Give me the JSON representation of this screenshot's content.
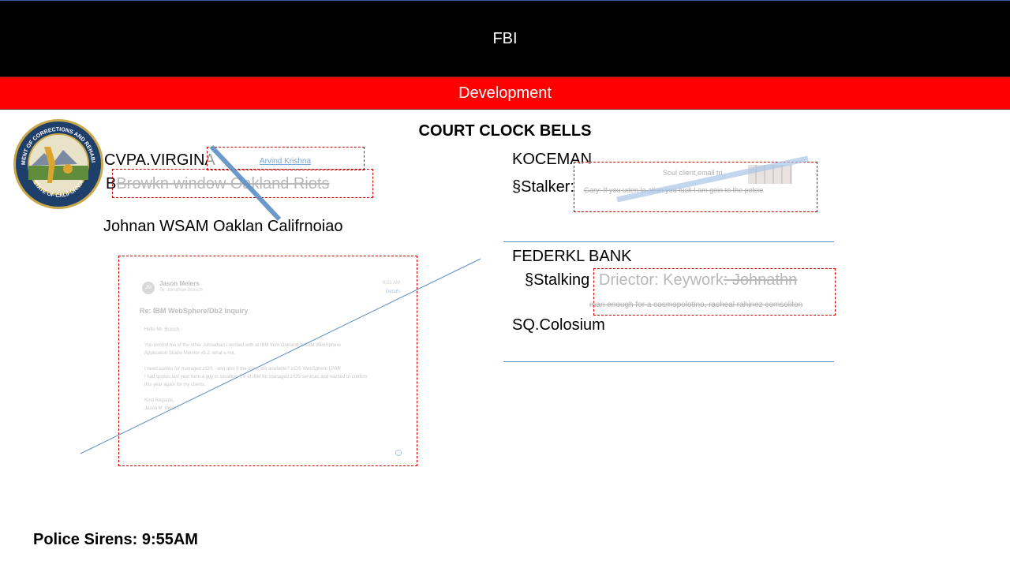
{
  "header": {
    "title": "FBI",
    "subtitle": "Development"
  },
  "heading": "COURT CLOCK BELLS",
  "left": {
    "line1": "CVPA.VIRGINA",
    "line2": "Browkn window Oakland Riots",
    "line3": "Johnan WSAM Oaklan Califrnoiao",
    "link_name": "Arvind Krishna"
  },
  "email": {
    "sender_initials": "JM",
    "sender": "Jason Meiers",
    "to": "To: Jonathan Brasch",
    "time": "9:55 AM",
    "details": "Details",
    "subject": "Re: IBM WebSphere/Db2 Inquiry",
    "greeting": "Hello Mr. Brasch,",
    "para1_a": "You remind me of the other Johnathan I worked with at IBM from Oakland WSAM WebSphere",
    "para1_b": "Application Studio Monitor v5.2. what a riot.",
    "para2_a": "I need quotes for managed z/OS - and also if the vid is still available? z/OS WebSphere LPAR",
    "para2_b": "I had quotes last year form a guy in situation. TX at IBM for managed z/OS services and wanted to confirm",
    "para2_c": "this year again for my clients.",
    "signoff": "Kind Regards,",
    "signature": "Jason M. Meiers"
  },
  "right": {
    "koceman": "KOCEMAN",
    "stalker": "§Stalker:",
    "small1": "Soul client,email tri",
    "small2": "Gary: If you uden la   ation you fuck I am goin to the polcie",
    "federkl": "FEDERKL BANK",
    "stalking": "§Stalking",
    "director": "Driector: Keywork",
    "director_strike": ": Johnathn",
    "small3": "man enough for a cosmopolotino, racheal rahinez comsoliton",
    "colosium": "SQ.Colosium"
  },
  "seal": {
    "top_text": "DEPARTMENT OF CORRECTIONS AND REHABILITATION",
    "bottom_text": "STATE OF CALIFORNIA"
  },
  "footer": "Police Sirens: 9:55AM",
  "colors": {
    "black": "#000000",
    "red": "#ff0000",
    "rule": "#5b8fc4",
    "dash": "#cc0000"
  }
}
